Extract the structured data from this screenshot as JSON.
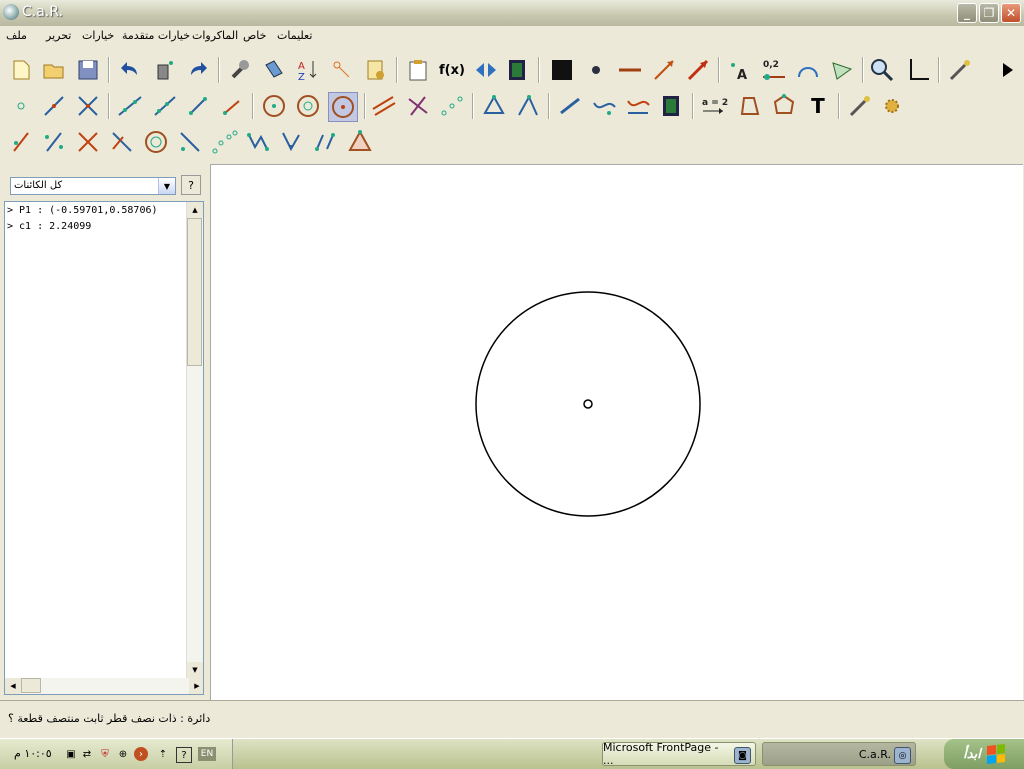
{
  "window": {
    "title": "C.a.R."
  },
  "menu": {
    "items": [
      "ملف",
      "تحرير",
      "خيارات",
      "خيارات متقدمة",
      "الماكروات",
      "خاص",
      "تعليمات"
    ]
  },
  "toolbar": {
    "fx_label": "f(x)",
    "point_label": "0,2",
    "assign_label": "a = 2",
    "text_tool_label": "T",
    "label_tool_label": "A"
  },
  "objects_panel": {
    "filter_value": "كل الكائنات",
    "help_label": "?",
    "items": [
      "> P1 : (-0.59701,0.58706)",
      "> c1 : 2.24099"
    ]
  },
  "status": {
    "text": "دائرة : ذات نصف قطر ثابت  منتصف قطعة ؟"
  },
  "taskbar": {
    "clock": "١٠:٠٥ م",
    "language": "EN",
    "tasks": [
      {
        "label": "Microsoft FrontPage - ...",
        "state": "inactive"
      },
      {
        "label": "C.a.R.",
        "state": "active"
      }
    ],
    "start_label": "ابدأ"
  },
  "colors": {
    "xp_face": "#ece9d8",
    "canvas_bg": "#ffffff",
    "title_bar": "#c8c8b0"
  }
}
